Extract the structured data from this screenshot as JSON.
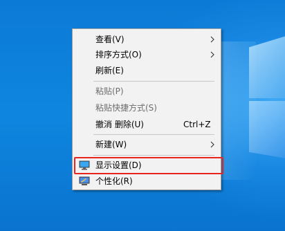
{
  "context_menu": {
    "items": [
      {
        "label": "查看(V)",
        "submenu": true
      },
      {
        "label": "排序方式(O)",
        "submenu": true
      },
      {
        "label": "刷新(E)"
      },
      {
        "label": "粘贴(P)",
        "disabled": true
      },
      {
        "label": "粘贴快捷方式(S)",
        "disabled": true
      },
      {
        "label": "撤消 删除(U)",
        "shortcut": "Ctrl+Z"
      },
      {
        "label": "新建(W)",
        "submenu": true
      },
      {
        "label": "显示设置(D)",
        "icon": "display-settings-icon",
        "highlighted": true
      },
      {
        "label": "个性化(R)",
        "icon": "personalize-icon"
      }
    ]
  },
  "colors": {
    "menu_bg": "#f2f2f2",
    "highlight_border": "#e8241f",
    "disabled_text": "#6d6d6d",
    "desktop_bg": "#0a78d7"
  }
}
